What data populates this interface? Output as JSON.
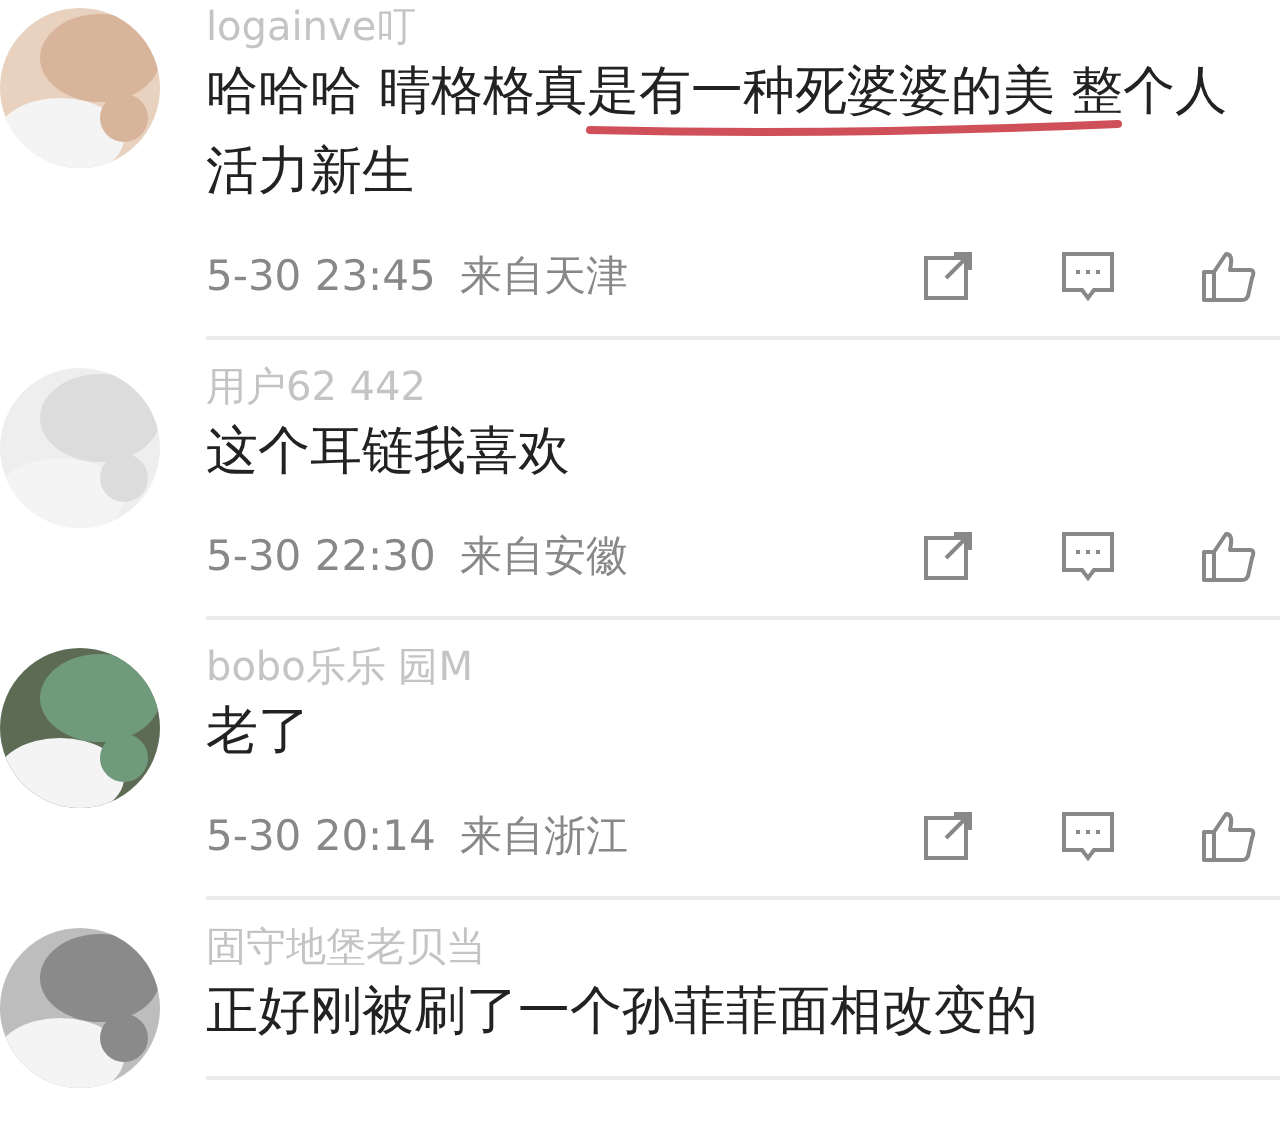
{
  "comments": [
    {
      "user": "logainve叮",
      "text": "哈哈哈 晴格格真是有一种死婆婆的美 整个人活力新生",
      "marked": true,
      "time": "5-30 23:45",
      "location": "来自天津"
    },
    {
      "user": "用户62 442",
      "text": "这个耳链我喜欢",
      "marked": false,
      "time": "5-30 22:30",
      "location": "来自安徽"
    },
    {
      "user": "bobo乐乐 园M",
      "text": "老了",
      "marked": false,
      "time": "5-30 20:14",
      "location": "来自浙江"
    },
    {
      "user": "固守地堡老贝当",
      "text": "正好刚被刷了一个孙菲菲面相改变的",
      "marked": false
    }
  ]
}
